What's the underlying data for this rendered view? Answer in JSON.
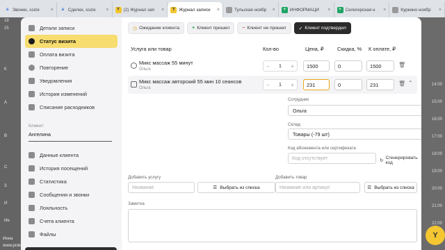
{
  "browser": {
    "tabs": [
      {
        "title": "Звонки, ssize",
        "favicon": "a",
        "color": "#3a6fd8"
      },
      {
        "title": "Сделки, ssize",
        "favicon": "a",
        "color": "#3a6fd8"
      },
      {
        "title": "(2) Журнал зап",
        "favicon": "Y",
        "color": "#f4c631"
      },
      {
        "title": "Журнал записи",
        "favicon": "Y",
        "color": "#f4c631",
        "active": true
      },
      {
        "title": "Тульская ноябр",
        "favicon": "doc",
        "color": "#888888"
      },
      {
        "title": "ИНФОРМАЦИ",
        "favicon": "+",
        "color": "#1fa463"
      },
      {
        "title": "Селигерская н",
        "favicon": "+",
        "color": "#1fa463"
      },
      {
        "title": "Куркино ноябр",
        "favicon": "doc",
        "color": "#888888"
      }
    ]
  },
  "background": {
    "top_numbers": [
      "18",
      "25"
    ],
    "left_letters": [
      "К",
      "А",
      "В",
      "С",
      "З",
      "И",
      "Ин"
    ],
    "right_hours": [
      "14:00",
      "15:00",
      "16:00",
      "17:00",
      "18:00",
      "19:00",
      "20:00",
      "21:00",
      "22:00"
    ],
    "bottom_text": [
      "Инна",
      "www.prokr"
    ]
  },
  "sidebar": {
    "items": [
      {
        "label": "Детали записи",
        "icon": "document-icon"
      },
      {
        "label": "Статус визита",
        "icon": "status-icon",
        "active": true
      },
      {
        "label": "Оплата визита",
        "icon": "card-icon"
      },
      {
        "label": "Повторение",
        "icon": "repeat-icon"
      },
      {
        "label": "Уведомления",
        "icon": "bell-icon"
      },
      {
        "label": "История изменений",
        "icon": "history-icon"
      },
      {
        "label": "Списание расходников",
        "icon": "list-icon"
      }
    ],
    "client_label": "Клиент:",
    "client_name": "Ангелина",
    "client_items": [
      {
        "label": "Данные клиента",
        "icon": "user-icon"
      },
      {
        "label": "История посещений",
        "icon": "history-icon"
      },
      {
        "label": "Статистика",
        "icon": "chart-icon"
      },
      {
        "label": "Сообщения и звонки",
        "icon": "message-icon"
      },
      {
        "label": "Лояльность",
        "icon": "loyalty-icon"
      },
      {
        "label": "Счета клиента",
        "icon": "wallet-icon"
      },
      {
        "label": "Файлы",
        "icon": "file-icon"
      }
    ]
  },
  "status_buttons": [
    {
      "label": "Ожидание клиента",
      "icon": "◷"
    },
    {
      "label": "Клиент пришел",
      "icon": "+"
    },
    {
      "label": "Клиент не пришел",
      "icon": "−"
    },
    {
      "label": "Клиент подтвердил",
      "icon": "✓",
      "active": true
    }
  ],
  "table": {
    "headers": {
      "service": "Услуга или товар",
      "qty": "Кол-во",
      "price": "Цена, ₽",
      "discount": "Скидка, %",
      "total": "К оплате, ₽"
    },
    "rows": [
      {
        "name": "Микс массаж 55 минут",
        "employee": "Ольга",
        "qty": "1",
        "price": "1500",
        "discount": "0",
        "total": "1500"
      },
      {
        "name": "Микс массаж авторский 55 мин 10 сеансов",
        "employee": "Ольга",
        "qty": "1",
        "price": "231",
        "discount": "0",
        "total": "231"
      }
    ]
  },
  "details": {
    "employee_label": "Сотрудник",
    "employee_value": "Ольга",
    "warehouse_label": "Склад",
    "warehouse_value": "Товары (-79 шт)",
    "code_label": "Код абонемента или сертификата",
    "code_placeholder": "Код отсутствует",
    "generate_label": "Сгенерировать код"
  },
  "add_service": {
    "label": "Добавить услугу",
    "placeholder": "Название",
    "button": "Выбрать из списка"
  },
  "add_product": {
    "label": "Добавить товар",
    "placeholder": "Название или артикул",
    "button": "Выбрать из списка"
  },
  "note": {
    "label": "Заметка"
  }
}
